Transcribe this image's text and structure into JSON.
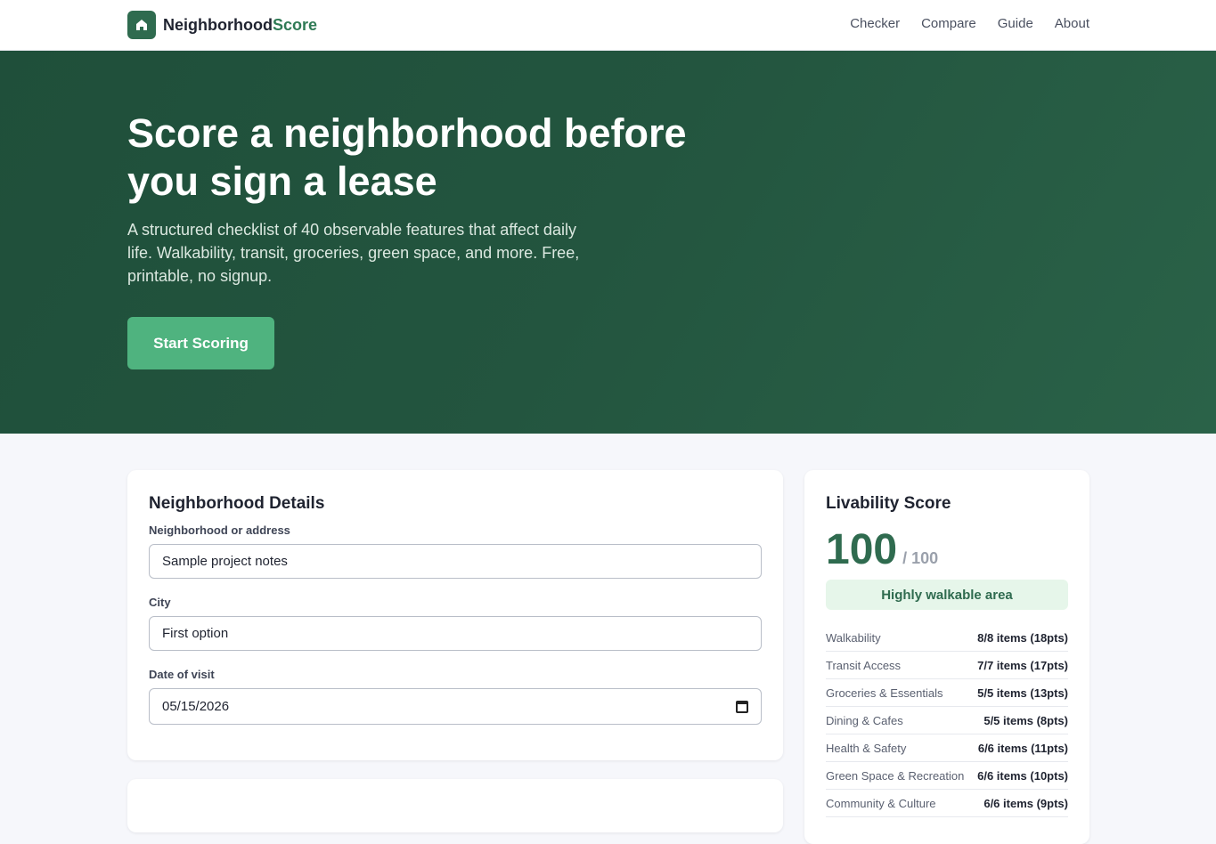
{
  "header": {
    "brand_main": "Neighborhood",
    "brand_accent": "Score",
    "logo_icon": "house-icon",
    "nav": [
      "Checker",
      "Compare",
      "Guide",
      "About"
    ]
  },
  "hero": {
    "title": "Score a neighborhood before you sign a lease",
    "subtitle": "A structured checklist of 40 observable features that affect daily life. Walkability, transit, groceries, green space, and more. Free, printable, no signup.",
    "cta": "Start Scoring"
  },
  "details": {
    "title": "Neighborhood Details",
    "address_label": "Neighborhood or address",
    "address_value": "Sample project notes",
    "city_label": "City",
    "city_value": "First option",
    "date_label": "Date of visit",
    "date_value": "05/15/2026"
  },
  "score": {
    "title": "Livability Score",
    "value": "100",
    "max": "/ 100",
    "badge": "Highly walkable area",
    "categories": [
      {
        "name": "Walkability",
        "value": "8/8 items (18pts)"
      },
      {
        "name": "Transit Access",
        "value": "7/7 items (17pts)"
      },
      {
        "name": "Groceries & Essentials",
        "value": "5/5 items (13pts)"
      },
      {
        "name": "Dining & Cafes",
        "value": "5/5 items (8pts)"
      },
      {
        "name": "Health & Safety",
        "value": "6/6 items (11pts)"
      },
      {
        "name": "Green Space & Recreation",
        "value": "6/6 items (10pts)"
      },
      {
        "name": "Community & Culture",
        "value": "6/6 items (9pts)"
      }
    ]
  },
  "colors": {
    "brand_green": "#2f6b4f",
    "accent_green": "#4fb37f",
    "badge_bg": "#e6f6ea"
  }
}
